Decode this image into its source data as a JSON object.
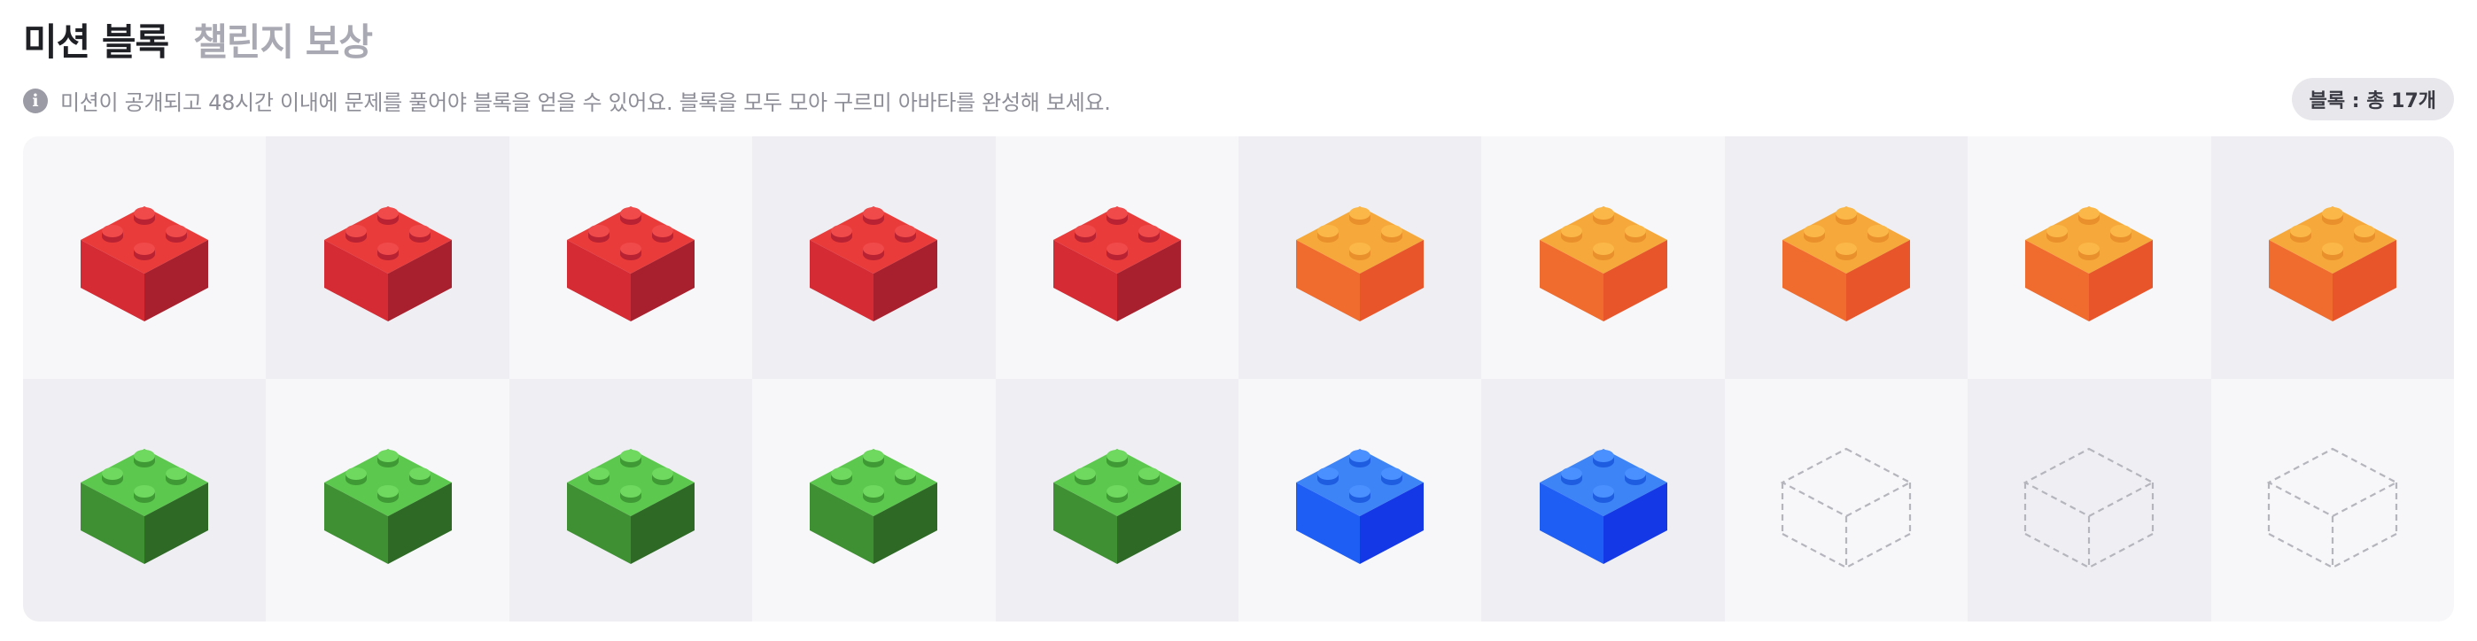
{
  "tabs": [
    {
      "label": "미션 블록",
      "active": true
    },
    {
      "label": "챌린지 보상",
      "active": false
    }
  ],
  "info": {
    "icon": "info-icon",
    "text": "미션이 공개되고 48시간 이내에 문제를 풀어야 블록을 얻을 수 있어요. 블록을 모두 모아 구르미 아바타를 완성해 보세요."
  },
  "count_badge": "블록 : 총 17개",
  "blocks": [
    {
      "color": "red",
      "collected": true
    },
    {
      "color": "red",
      "collected": true
    },
    {
      "color": "red",
      "collected": true
    },
    {
      "color": "red",
      "collected": true
    },
    {
      "color": "red",
      "collected": true
    },
    {
      "color": "orange",
      "collected": true
    },
    {
      "color": "orange",
      "collected": true
    },
    {
      "color": "orange",
      "collected": true
    },
    {
      "color": "orange",
      "collected": true
    },
    {
      "color": "orange",
      "collected": true
    },
    {
      "color": "green",
      "collected": true
    },
    {
      "color": "green",
      "collected": true
    },
    {
      "color": "green",
      "collected": true
    },
    {
      "color": "green",
      "collected": true
    },
    {
      "color": "green",
      "collected": true
    },
    {
      "color": "blue",
      "collected": true
    },
    {
      "color": "blue",
      "collected": true
    },
    {
      "color": "empty",
      "collected": false
    },
    {
      "color": "empty",
      "collected": false
    },
    {
      "color": "empty",
      "collected": false
    }
  ],
  "palette": {
    "red": {
      "top": "#ea3b3b",
      "left": "#d42b35",
      "right": "#a81f2e",
      "stud": "#f04a4a",
      "studSide": "#b82232"
    },
    "orange": {
      "top": "#f6a93a",
      "left": "#f06b2e",
      "right": "#e8552a",
      "stud": "#fbb848",
      "studSide": "#e98f2b"
    },
    "green": {
      "top": "#5cc94e",
      "left": "#3f8f33",
      "right": "#2e6a26",
      "stud": "#6fd85f",
      "studSide": "#3f9a35"
    },
    "blue": {
      "top": "#3d84f7",
      "left": "#1f5ef5",
      "right": "#1538e6",
      "stud": "#4a90ff",
      "studSide": "#1f5de0"
    },
    "empty": {
      "outline": "#b5b5bd"
    }
  }
}
